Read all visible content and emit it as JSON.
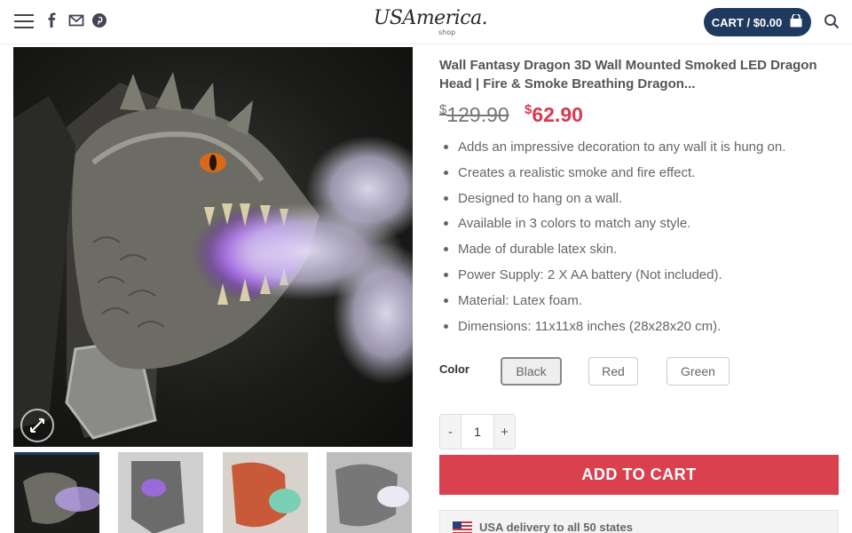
{
  "header": {
    "logo_main": "USAmerica.",
    "logo_sub": "shop",
    "cart_label": "CART / $0.00"
  },
  "product": {
    "title": "Wall Fantasy Dragon 3D Wall Mounted Smoked LED Dragon Head | Fire & Smoke Breathing Dragon...",
    "currency": "$",
    "old_price": "129.90",
    "new_price": "62.90",
    "features": [
      "Adds an impressive decoration to any wall it is hung on.",
      "Creates a realistic smoke and fire effect.",
      "Designed to hang on a wall.",
      "Available in 3 colors to match any style.",
      "Made of durable latex skin.",
      "Power Supply: 2 X AA battery (Not included).",
      "Material: Latex foam.",
      "Dimensions: 11x11x8 inches (28x28x20 cm)."
    ],
    "color_label": "Color",
    "colors": [
      "Black",
      "Red",
      "Green"
    ],
    "selected_color": "Black",
    "quantity": "1",
    "qty_minus": "-",
    "qty_plus": "+",
    "add_to_cart": "ADD TO CART",
    "delivery": "USA delivery to all 50 states"
  },
  "icons": [
    "menu-icon",
    "facebook-icon",
    "email-icon",
    "pinterest-icon",
    "cart-icon",
    "search-icon",
    "zoom-icon",
    "us-flag-icon"
  ],
  "colors": {
    "brand_navy": "#1f3a5f",
    "sale_red": "#d83a4e",
    "button_red": "#d9414f"
  }
}
